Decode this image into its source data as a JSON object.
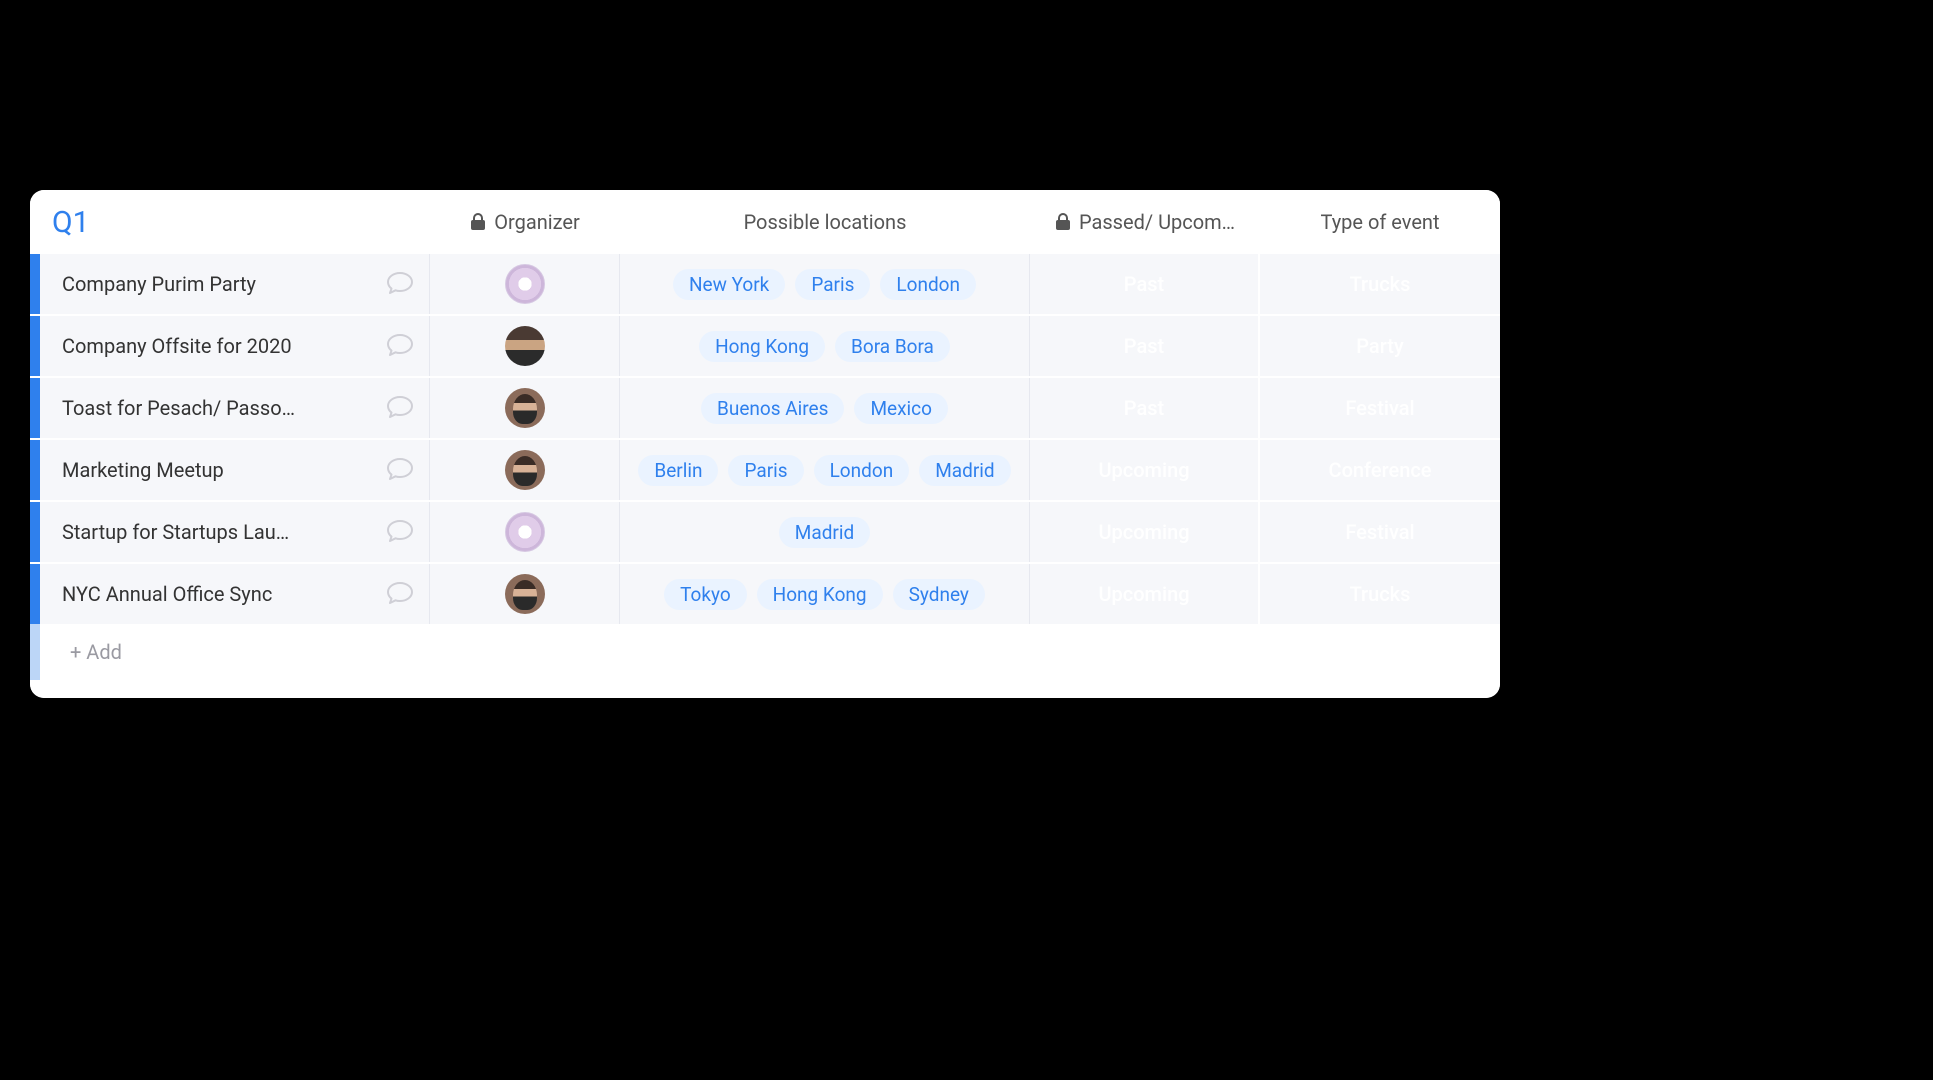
{
  "group": {
    "title": "Q1"
  },
  "columns": {
    "organizer": "Organizer",
    "locations": "Possible locations",
    "status": "Passed/ Upcom…",
    "type": "Type of event"
  },
  "status_colors": {
    "Past": "c-past",
    "Upcoming": "c-upcoming"
  },
  "type_colors": {
    "Trucks": "c-trucks",
    "Party": "c-party",
    "Festival": "c-festival",
    "Conference": "c-conf"
  },
  "rows": [
    {
      "name": "Company Purim Party",
      "avatar": "flower",
      "locations": [
        "New York",
        "Paris",
        "London"
      ],
      "status": "Past",
      "type": "Trucks"
    },
    {
      "name": "Company Offsite for 2020",
      "avatar": "person-a",
      "locations": [
        "Hong Kong",
        "Bora Bora"
      ],
      "status": "Past",
      "type": "Party"
    },
    {
      "name": "Toast for Pesach/ Passo…",
      "avatar": "person-b",
      "locations": [
        "Buenos Aires",
        "Mexico"
      ],
      "status": "Past",
      "type": "Festival"
    },
    {
      "name": "Marketing Meetup",
      "avatar": "person-b",
      "locations": [
        "Berlin",
        "Paris",
        "London",
        "Madrid"
      ],
      "status": "Upcoming",
      "type": "Conference"
    },
    {
      "name": "Startup for Startups Lau…",
      "avatar": "flower",
      "locations": [
        "Madrid"
      ],
      "status": "Upcoming",
      "type": "Festival"
    },
    {
      "name": "NYC Annual Office Sync",
      "avatar": "person-b",
      "locations": [
        "Tokyo",
        "Hong Kong",
        "Sydney"
      ],
      "status": "Upcoming",
      "type": "Trucks"
    }
  ],
  "add_row_label": "+ Add"
}
